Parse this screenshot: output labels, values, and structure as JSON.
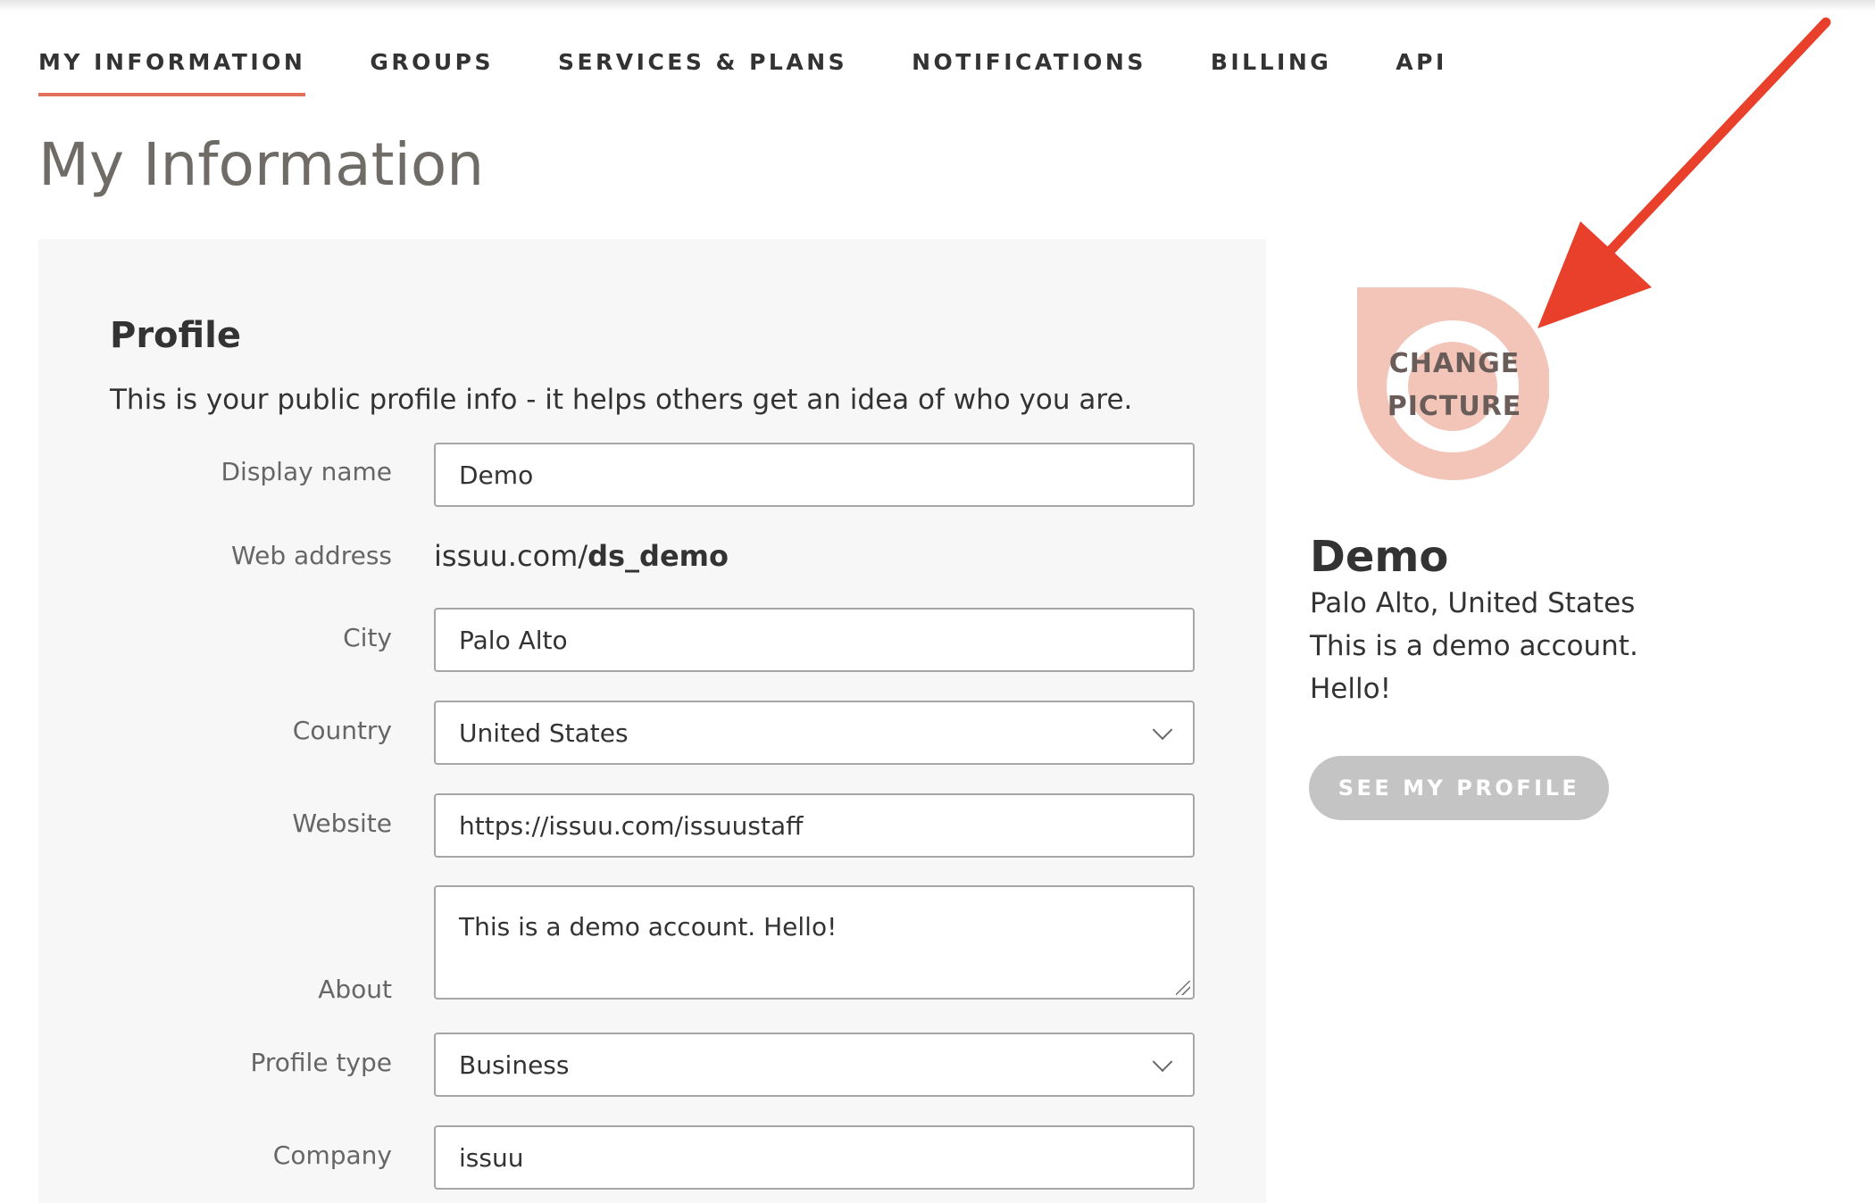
{
  "tabs": [
    {
      "label": "MY INFORMATION",
      "active": true
    },
    {
      "label": "GROUPS",
      "active": false
    },
    {
      "label": "SERVICES & PLANS",
      "active": false
    },
    {
      "label": "NOTIFICATIONS",
      "active": false
    },
    {
      "label": "BILLING",
      "active": false
    },
    {
      "label": "API",
      "active": false
    }
  ],
  "page_title": "My Information",
  "profile": {
    "heading": "Profile",
    "description": "This is your public profile info - it helps others get an idea of who you are.",
    "fields": {
      "display_name": {
        "label": "Display name",
        "value": "Demo"
      },
      "web_address": {
        "label": "Web address",
        "prefix": "issuu.com/",
        "handle": "ds_demo"
      },
      "city": {
        "label": "City",
        "value": "Palo Alto"
      },
      "country": {
        "label": "Country",
        "value": "United States"
      },
      "website": {
        "label": "Website",
        "value": "https://issuu.com/issuustaff"
      },
      "about": {
        "label": "About",
        "value": "This is a demo account. Hello!"
      },
      "profile_type": {
        "label": "Profile type",
        "value": "Business"
      },
      "company": {
        "label": "Company",
        "value": "issuu"
      }
    }
  },
  "avatar": {
    "line1": "CHANGE",
    "line2": "PICTURE",
    "color": "#f2c5b8"
  },
  "card": {
    "name": "Demo",
    "location": "Palo Alto, United States",
    "about_line1": "This is a demo account.",
    "about_line2": "Hello!",
    "button": "SEE MY PROFILE"
  },
  "colors": {
    "accent": "#e36f5d",
    "arrow": "#e8402b"
  }
}
